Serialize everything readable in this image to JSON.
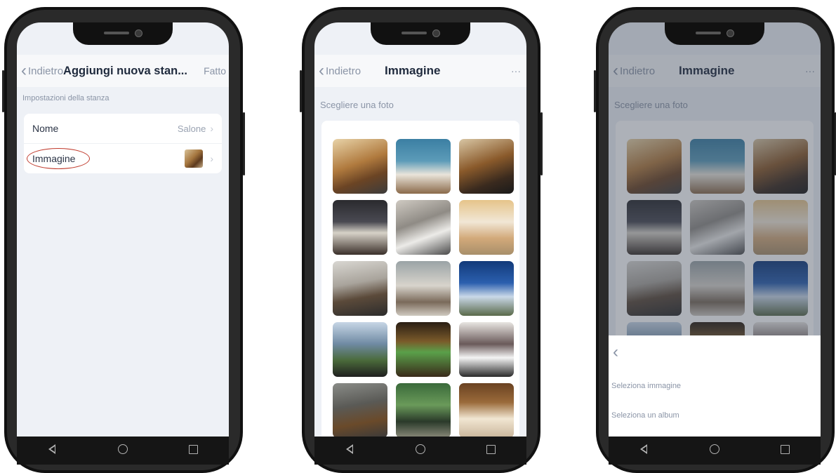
{
  "phone1": {
    "nav": {
      "back_label": "Indietro",
      "title": "Aggiungi nuova stan...",
      "action": "Fatto"
    },
    "section_label": "Impostazioni della stanza",
    "rows": [
      {
        "label": "Nome",
        "value": "Salone"
      },
      {
        "label": "Immagine",
        "value": ""
      }
    ]
  },
  "phone2": {
    "nav": {
      "back_label": "Indietro",
      "title": "Immagine",
      "more": "···"
    },
    "section_label": "Scegliere una foto",
    "photos": [
      {
        "name": "living-room-wood"
      },
      {
        "name": "dining-blue-shelves"
      },
      {
        "name": "office-desk"
      },
      {
        "name": "bedroom-dark"
      },
      {
        "name": "bedroom-grey"
      },
      {
        "name": "kids-room"
      },
      {
        "name": "dining-modern"
      },
      {
        "name": "bathroom"
      },
      {
        "name": "house-night"
      },
      {
        "name": "terrace-sea-view"
      },
      {
        "name": "home-theater"
      },
      {
        "name": "kitchen-white"
      },
      {
        "name": "stone-fireplace"
      },
      {
        "name": "garden-patio"
      },
      {
        "name": "wood-ceiling-dining"
      }
    ]
  },
  "phone3": {
    "nav": {
      "back_label": "Indietro",
      "title": "Immagine",
      "more": "···"
    },
    "section_label": "Scegliere una foto",
    "sheet": {
      "option1": "Seleziona immagine",
      "option2": "Seleziona un album"
    }
  },
  "colors": {
    "accent": "#1f2a3d",
    "muted": "#8a94a6",
    "background": "#eef1f6",
    "highlight": "#c0392b"
  }
}
